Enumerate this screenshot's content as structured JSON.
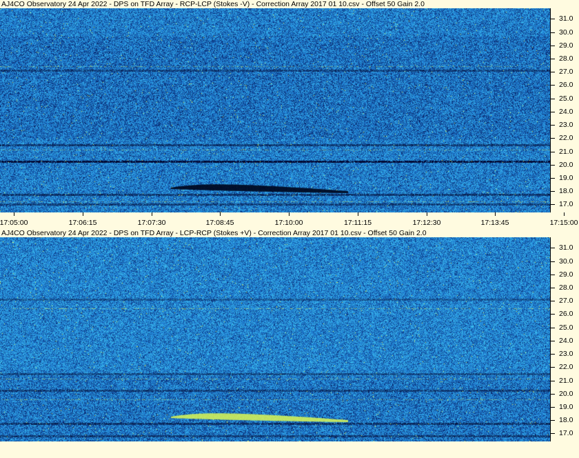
{
  "panels": [
    {
      "id": "top",
      "title": "AJ4CO Observatory 24 Apr 2022  -  DPS on TFD Array  -  RCP-LCP (Stokes -V)  -  Correction Array 2017 01 10.csv  -  Offset 50  Gain 2.0",
      "burst_tone": "dark"
    },
    {
      "id": "bottom",
      "title": "AJ4CO Observatory 24 Apr 2022  -  DPS on TFD Array  -  LCP-RCP (Stokes +V)  -  Correction Array 2017 01 10.csv  -  Offset 50  Gain 2.0",
      "burst_tone": "bright"
    }
  ],
  "frequency_axis": {
    "unit": "MHz",
    "range": [
      16.4,
      31.8
    ],
    "labels": [
      "31.0",
      "30.0",
      "29.0",
      "28.0",
      "27.0",
      "26.0",
      "25.0",
      "24.0",
      "23.0",
      "22.0",
      "21.0",
      "20.0",
      "19.0",
      "18.0",
      "17.0"
    ],
    "values": [
      31.0,
      30.0,
      29.0,
      28.0,
      27.0,
      26.0,
      25.0,
      24.0,
      23.0,
      22.0,
      21.0,
      20.0,
      19.0,
      18.0,
      17.0
    ]
  },
  "time_axis": {
    "labels": [
      "17:05:00",
      "17:06:15",
      "17:07:30",
      "17:08:45",
      "17:10:00",
      "17:11:15",
      "17:12:30",
      "17:13:45",
      "17:15:00"
    ],
    "start": "17:05:00",
    "end": "17:15:00"
  },
  "colors": {
    "background": "#fffbe0",
    "spectrogram_base": "#0b3f8c",
    "noise_low": "#061a5c",
    "noise_mid": "#1f7fd6",
    "noise_high": "#42c8f0",
    "highlight": "#d8f060"
  }
}
